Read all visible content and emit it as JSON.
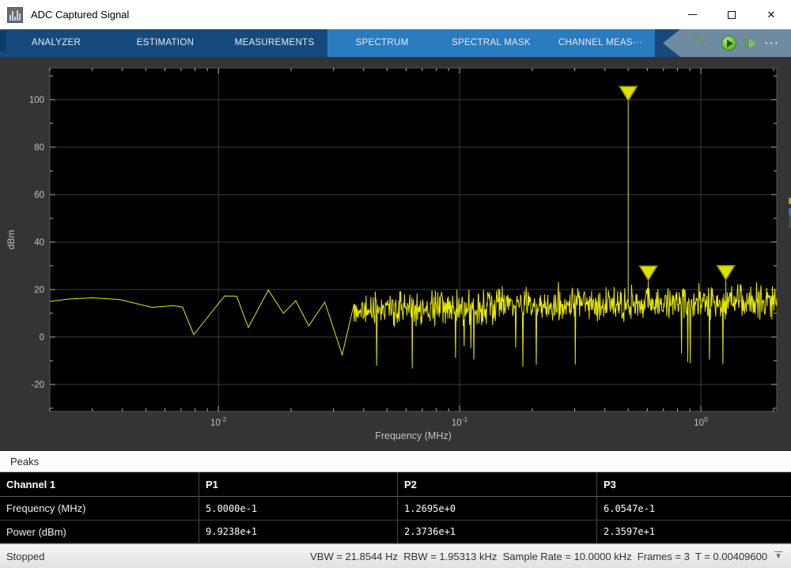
{
  "window": {
    "title": "ADC Captured Signal"
  },
  "toolstrip": {
    "tabs": [
      {
        "label": "ANALYZER"
      },
      {
        "label": "ESTIMATION"
      },
      {
        "label": "MEASUREMENTS"
      },
      {
        "label": "SPECTRUM"
      },
      {
        "label": "SPECTRAL MASK"
      },
      {
        "label": "CHANNEL MEAS···"
      }
    ],
    "quick_actions": {
      "more_label": "···"
    },
    "colors": {
      "dark_blue": "#174a7c",
      "context_blue": "#2b7bbf",
      "chevron_gray": "#6e8ba2",
      "run_green": "#76bf43"
    }
  },
  "chart_data": {
    "type": "line",
    "xlabel": "Frequency (MHz)",
    "ylabel": "dBm",
    "x_scale": "log",
    "x_range_mhz": [
      0.002,
      2.064
    ],
    "y_ticks_dbm": [
      -20,
      0,
      20,
      40,
      60,
      80,
      100
    ],
    "x_decade_exponents": [
      -2,
      -1,
      0
    ],
    "tick_base": "10",
    "trace_color": "#e8e800",
    "grid_color": "#3b3b3b",
    "marker_fill": "#e0e000",
    "marker_stroke": "#8a8a00",
    "peaks": [
      {
        "id": "P1",
        "freq_mhz": 0.5,
        "power_dbm": 99.238
      },
      {
        "id": "P2",
        "freq_mhz": 1.2695,
        "power_dbm": 23.736
      },
      {
        "id": "P3",
        "freq_mhz": 0.60547,
        "power_dbm": 23.597
      }
    ],
    "sparse_trace_dbm": [
      [
        0.002,
        15.0
      ],
      [
        0.0024,
        16.0
      ],
      [
        0.003,
        16.5
      ],
      [
        0.0039,
        15.8
      ],
      [
        0.0053,
        12.5
      ],
      [
        0.0065,
        13.2
      ],
      [
        0.0071,
        12.6
      ],
      [
        0.0079,
        1.0
      ],
      [
        0.0093,
        10.0
      ],
      [
        0.0106,
        17.3
      ],
      [
        0.0119,
        17.2
      ],
      [
        0.0133,
        4.0
      ],
      [
        0.0161,
        19.8
      ],
      [
        0.0186,
        10.0
      ],
      [
        0.0209,
        15.3
      ],
      [
        0.0237,
        4.7
      ],
      [
        0.0276,
        14.7
      ],
      [
        0.0326,
        -7.5
      ],
      [
        0.0365,
        14.0
      ]
    ],
    "noise_model": {
      "f_start_mhz": 0.0365,
      "f_end_mhz": 2.064,
      "points": 880,
      "floor_start_dbm": 11.5,
      "floor_end_dbm": 15.5,
      "jitter_dbm": 6.5,
      "dip_probability": 0.02,
      "spike_probability": 0.012,
      "clamp_dbm": [
        -16,
        26
      ],
      "seed": 987654
    }
  },
  "peaks_panel": {
    "title": "Peaks",
    "table": {
      "headers": [
        "Channel 1",
        "P1",
        "P2",
        "P3"
      ],
      "rows": [
        {
          "label": "Frequency (MHz)",
          "values": [
            "5.0000e-1",
            "1.2695e+0",
            "6.0547e-1"
          ]
        },
        {
          "label": "Power (dBm)",
          "values": [
            "9.9238e+1",
            "2.3736e+1",
            "2.3597e+1"
          ]
        }
      ]
    }
  },
  "statusbar": {
    "state": "Stopped",
    "info": "VBW = 21.8544 Hz  RBW = 1.95313 kHz  Sample Rate = 10.0000 kHz  Frames = 3  T = 0.00409600"
  }
}
